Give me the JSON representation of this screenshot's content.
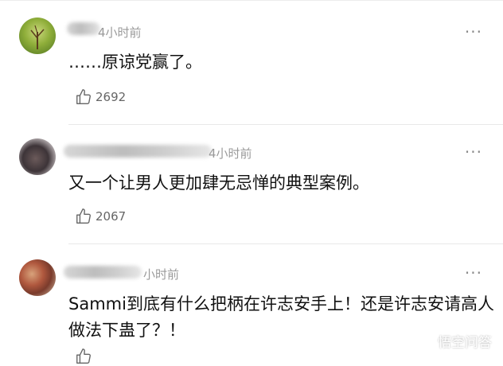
{
  "comments": [
    {
      "time": "4小时前",
      "text": "……原谅党赢了。",
      "likes": "2692"
    },
    {
      "time": "4小时前",
      "text": "又一个让男人更加肆无忌惮的典型案例。",
      "likes": "2067"
    },
    {
      "time": "小时前",
      "text": "Sammi到底有什么把柄在许志安手上！还是许志安请高人做法下蛊了？！",
      "likes": ""
    }
  ],
  "more_label": "···",
  "watermark": {
    "label": "悟空问答",
    "icon": "wukong-logo-icon"
  },
  "colors": {
    "time": "#9a9a9a",
    "divider": "#e8e8e8",
    "text": "#111111"
  }
}
